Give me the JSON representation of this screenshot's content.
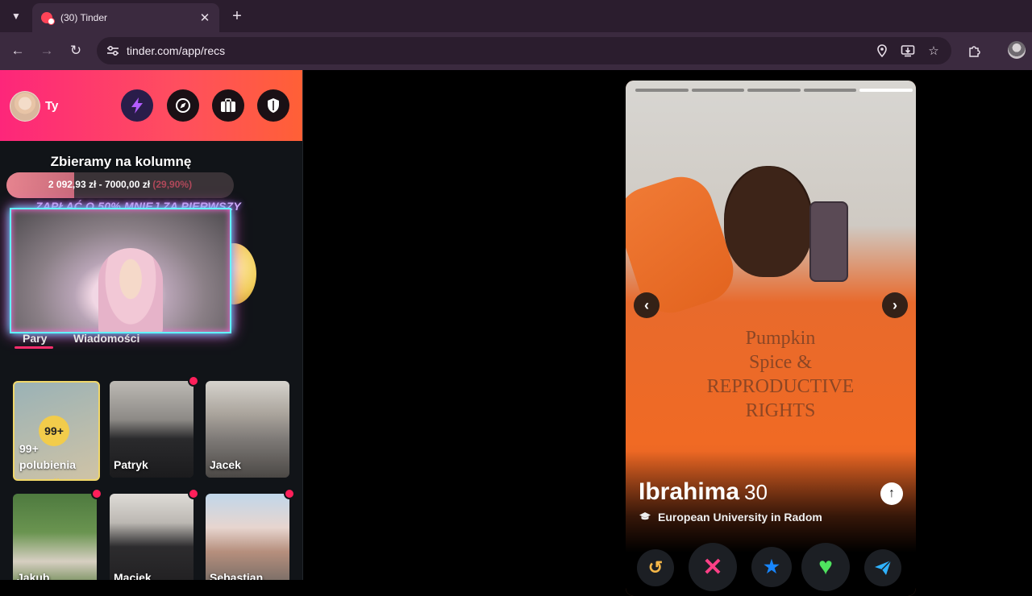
{
  "browser": {
    "tab_title": "(30) Tinder",
    "url": "tinder.com/app/recs"
  },
  "sidebar": {
    "user_name": "Ty",
    "goal": {
      "title": "Zbieramy na kolumnę",
      "current": "2 092,93 zł",
      "target": "7000,00 zł",
      "percent_text": "(29,90%)",
      "progress_fraction": 0.299
    },
    "promo": "ZAPŁAĆ O 50% MNIEJ ZA PIERWSZY",
    "tabs": {
      "matches": "Pary",
      "messages": "Wiadomości"
    },
    "likes_card": {
      "count": "99+",
      "label_top": "99+",
      "label_bottom": "polubienia"
    },
    "matches": [
      {
        "name": "Patryk"
      },
      {
        "name": "Jacek"
      },
      {
        "name": "Jakub"
      },
      {
        "name": "Maciek"
      },
      {
        "name": "Sebastian"
      }
    ]
  },
  "profile": {
    "name": "Ibrahima",
    "age": "30",
    "school": "European University in Radom",
    "photo_count": 5,
    "active_photo_index": 4,
    "photo_print": "Pumpkin\nSpice &\nREPRODUCTIVE\nRIGHTS"
  },
  "colors": {
    "brand_gradient_start": "#fd267a",
    "brand_gradient_end": "#ff6036",
    "rewind": "#f5b748",
    "nope": "#ff3f86",
    "super_like": "#1786ff",
    "like": "#4fe35f",
    "boost": "#2fb2ff"
  }
}
